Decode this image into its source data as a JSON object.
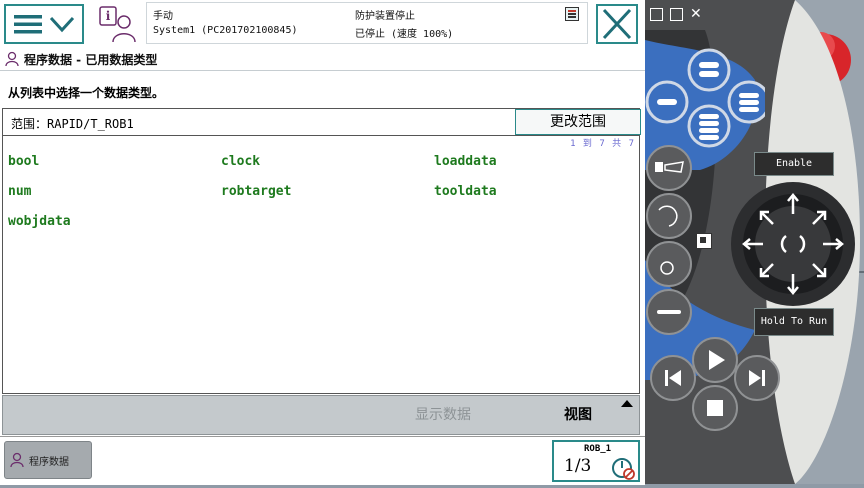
{
  "header": {
    "mode": "手动",
    "system": "System1 (PC201702100845)",
    "guard_status": "防护装置停止",
    "run_status": "已停止 (速度 100%)"
  },
  "window": {
    "title": "程序数据 - 已用数据类型"
  },
  "main": {
    "instruction": "从列表中选择一个数据类型。",
    "scope_label": "范围：RAPID/T_ROB1",
    "change_scope_label": "更改范围",
    "pager": "1 到 7 共 7",
    "data_types": [
      "bool",
      "clock",
      "loaddata",
      "num",
      "robtarget",
      "tooldata",
      "wobjdata"
    ]
  },
  "command_bar": {
    "show_data_label": "显示数据",
    "view_label": "视图"
  },
  "taskbar": {
    "task_label": "程序数据",
    "robot_label": "ROB_1",
    "robot_fraction": "1/3"
  },
  "pendant": {
    "enable_label": "Enable",
    "hold_label": "Hold To Run"
  },
  "colors": {
    "accent": "#2a8a8a",
    "datatype_text": "#1e7a1e",
    "pendant_blue": "#3b6fbf",
    "estop_red": "#d8252a",
    "estop_yellow": "#f5d800"
  }
}
